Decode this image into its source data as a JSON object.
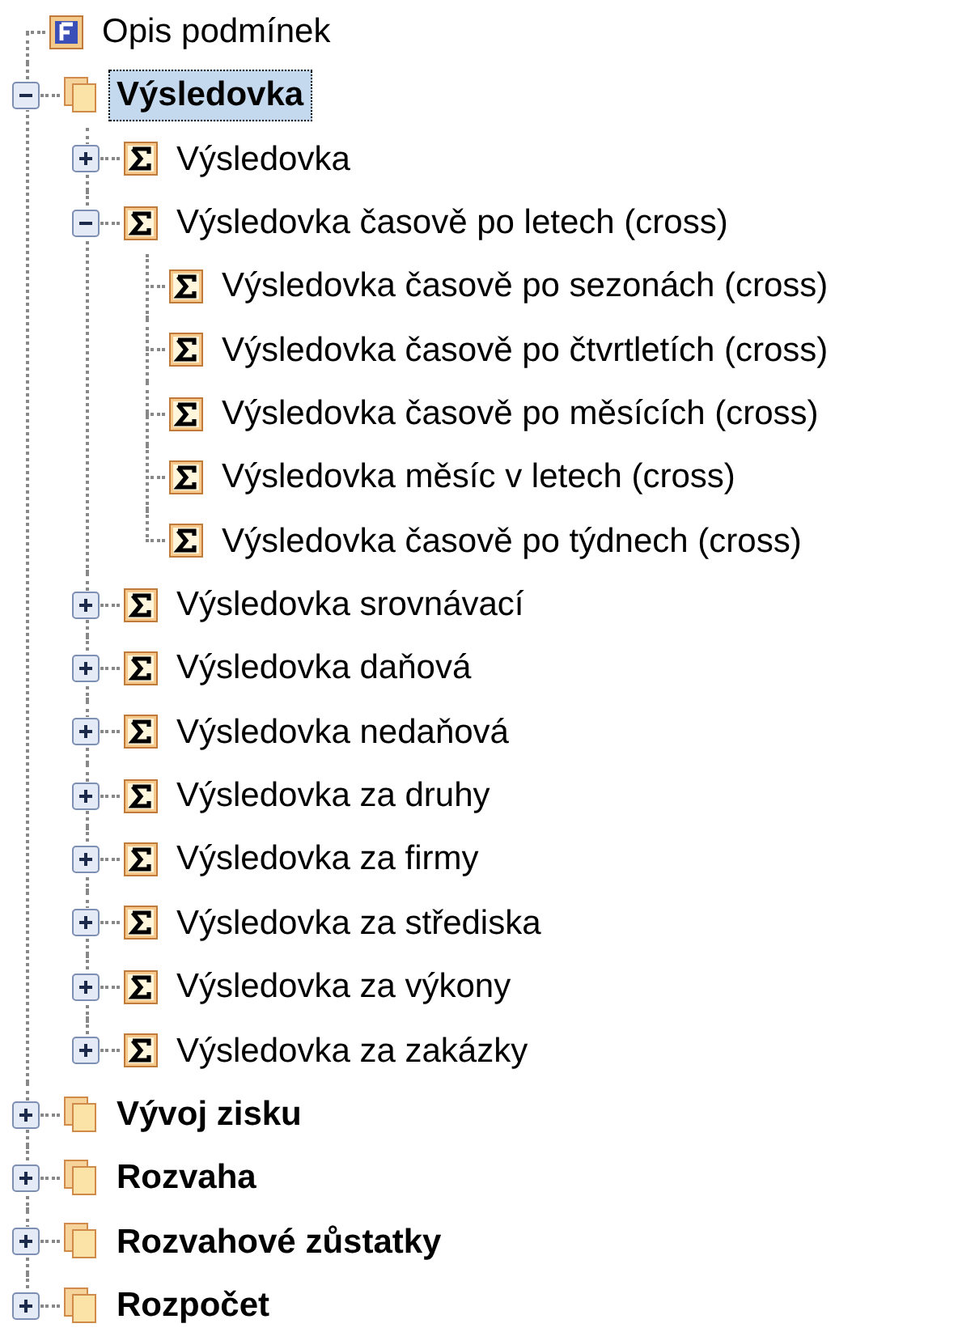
{
  "tree": [
    {
      "label": "Opis podmínek",
      "kind": "form",
      "selected": false
    },
    {
      "label": "Výsledovka",
      "kind": "folder",
      "selected": true,
      "expanded": true,
      "children": [
        {
          "label": "Výsledovka",
          "kind": "sigma",
          "selected": false,
          "expanded": false
        },
        {
          "label": "Výsledovka časově po letech (cross)",
          "kind": "sigma",
          "selected": false,
          "expanded": true,
          "children": [
            {
              "label": "Výsledovka časově po sezonách (cross)",
              "kind": "sigma",
              "selected": false
            },
            {
              "label": "Výsledovka časově po čtvrtletích (cross)",
              "kind": "sigma",
              "selected": false
            },
            {
              "label": "Výsledovka časově po měsících (cross)",
              "kind": "sigma",
              "selected": false
            },
            {
              "label": "Výsledovka měsíc v letech (cross)",
              "kind": "sigma",
              "selected": false
            },
            {
              "label": "Výsledovka časově po týdnech (cross)",
              "kind": "sigma",
              "selected": false
            }
          ]
        },
        {
          "label": "Výsledovka srovnávací",
          "kind": "sigma",
          "selected": false,
          "expanded": false
        },
        {
          "label": "Výsledovka daňová",
          "kind": "sigma",
          "selected": false,
          "expanded": false
        },
        {
          "label": "Výsledovka nedaňová",
          "kind": "sigma",
          "selected": false,
          "expanded": false
        },
        {
          "label": "Výsledovka za druhy",
          "kind": "sigma",
          "selected": false,
          "expanded": false
        },
        {
          "label": "Výsledovka za firmy",
          "kind": "sigma",
          "selected": false,
          "expanded": false
        },
        {
          "label": "Výsledovka za střediska",
          "kind": "sigma",
          "selected": false,
          "expanded": false
        },
        {
          "label": "Výsledovka za výkony",
          "kind": "sigma",
          "selected": false,
          "expanded": false
        },
        {
          "label": "Výsledovka za zakázky",
          "kind": "sigma",
          "selected": false,
          "expanded": false
        }
      ]
    },
    {
      "label": "Vývoj zisku",
      "kind": "folder",
      "selected": false,
      "expanded": false
    },
    {
      "label": "Rozvaha",
      "kind": "folder",
      "selected": false,
      "expanded": false
    },
    {
      "label": "Rozvahové zůstatky",
      "kind": "folder",
      "selected": false,
      "expanded": false
    },
    {
      "label": "Rozpočet",
      "kind": "folder",
      "selected": false,
      "expanded": false
    }
  ]
}
